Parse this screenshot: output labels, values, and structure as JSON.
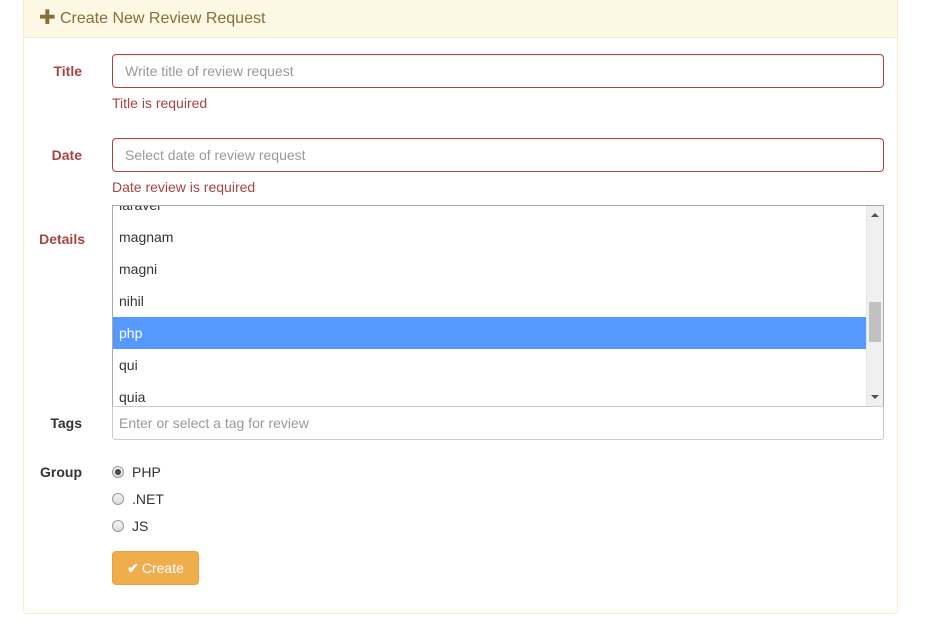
{
  "panel": {
    "heading_icon": "plus-icon",
    "heading_icon_glyph": "✚",
    "title": "Create New Review Request"
  },
  "form": {
    "title": {
      "label": "Title",
      "value": "",
      "placeholder": "Write title of review request",
      "error": "Title is required"
    },
    "date": {
      "label": "Date",
      "value": "",
      "placeholder": "Select date of review request",
      "error": "Date review is required"
    },
    "details": {
      "label": "Details",
      "options": [
        "laravel",
        "magnam",
        "magni",
        "nihil",
        "php",
        "qui",
        "quia"
      ],
      "selected": "php"
    },
    "tags": {
      "label": "Tags",
      "value": "",
      "placeholder": "Enter or select a tag for review"
    },
    "group": {
      "label": "Group",
      "options": [
        "PHP",
        ".NET",
        "JS"
      ],
      "selected": "PHP"
    },
    "submit": {
      "icon": "check-icon",
      "icon_glyph": "✔",
      "label": "Create"
    }
  },
  "colors": {
    "error": "#a94442",
    "heading_bg": "#fcf8e3",
    "heading_text": "#8a6d3b",
    "selected_option": "#5599ff",
    "button": "#f0ad4e"
  }
}
